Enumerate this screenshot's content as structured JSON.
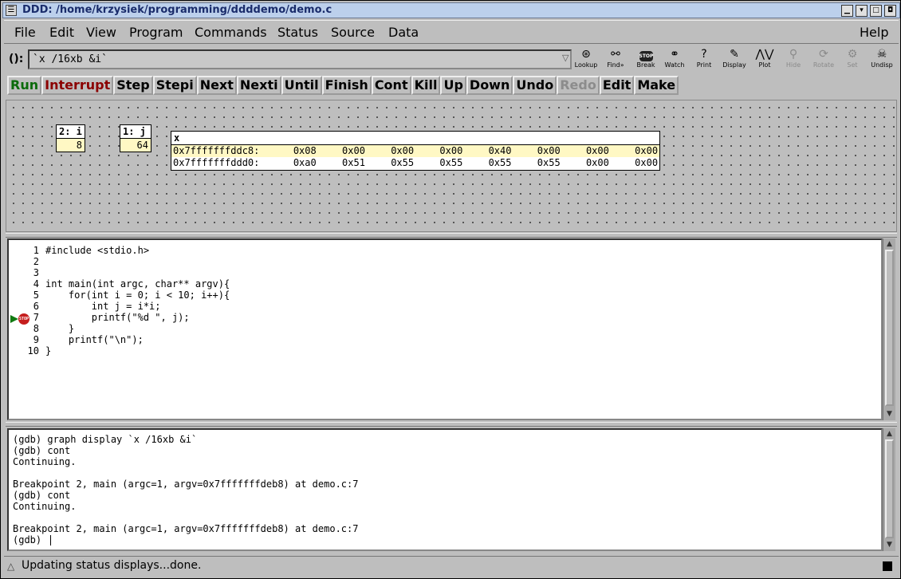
{
  "window": {
    "title": "DDD: /home/krzysiek/programming/ddddemo/demo.c"
  },
  "menubar": {
    "items": [
      "File",
      "Edit",
      "View",
      "Program",
      "Commands",
      "Status",
      "Source",
      "Data"
    ],
    "help": "Help"
  },
  "argbar": {
    "label": "():",
    "value": "`x /16xb &i`"
  },
  "toolbar": [
    {
      "label": "Lookup",
      "icon": "lookup-icon",
      "enabled": true
    },
    {
      "label": "Find»",
      "icon": "binoculars-icon",
      "enabled": true
    },
    {
      "label": "Break",
      "icon": "stop-sign-icon",
      "enabled": true
    },
    {
      "label": "Watch",
      "icon": "glasses-icon",
      "enabled": true
    },
    {
      "label": "Print",
      "icon": "question-icon",
      "enabled": true
    },
    {
      "label": "Display",
      "icon": "display-icon",
      "enabled": true
    },
    {
      "label": "Plot",
      "icon": "plot-icon",
      "enabled": true
    },
    {
      "label": "Hide",
      "icon": "magnifier-icon",
      "enabled": false
    },
    {
      "label": "Rotate",
      "icon": "rotate-icon",
      "enabled": false
    },
    {
      "label": "Set",
      "icon": "gear-icon",
      "enabled": false
    },
    {
      "label": "Undisp",
      "icon": "skull-icon",
      "enabled": true
    }
  ],
  "commands": [
    {
      "label": "Run",
      "style": "run"
    },
    {
      "label": "Interrupt",
      "style": "interrupt"
    },
    {
      "label": "Step",
      "style": ""
    },
    {
      "label": "Stepi",
      "style": ""
    },
    {
      "label": "Next",
      "style": ""
    },
    {
      "label": "Nexti",
      "style": ""
    },
    {
      "label": "Until",
      "style": ""
    },
    {
      "label": "Finish",
      "style": ""
    },
    {
      "label": "Cont",
      "style": ""
    },
    {
      "label": "Kill",
      "style": ""
    },
    {
      "label": "Up",
      "style": ""
    },
    {
      "label": "Down",
      "style": ""
    },
    {
      "label": "Undo",
      "style": ""
    },
    {
      "label": "Redo",
      "style": "disabled"
    },
    {
      "label": "Edit",
      "style": ""
    },
    {
      "label": "Make",
      "style": ""
    }
  ],
  "displays": {
    "i": {
      "header": "2: i",
      "value": "8"
    },
    "j": {
      "header": "1: j",
      "value": "64"
    },
    "x": {
      "header": "x",
      "rows": [
        {
          "addr": "0x7fffffffddc8:",
          "bytes": [
            "0x08",
            "0x00",
            "0x00",
            "0x00",
            "0x40",
            "0x00",
            "0x00",
            "0x00"
          ],
          "changed": true
        },
        {
          "addr": "0x7fffffffddd0:",
          "bytes": [
            "0xa0",
            "0x51",
            "0x55",
            "0x55",
            "0x55",
            "0x55",
            "0x00",
            "0x00"
          ],
          "changed": false
        }
      ]
    }
  },
  "source": {
    "lines": [
      {
        "n": "1",
        "code": "#include <stdio.h>"
      },
      {
        "n": "2",
        "code": ""
      },
      {
        "n": "3",
        "code": ""
      },
      {
        "n": "4",
        "code": "int main(int argc, char** argv){"
      },
      {
        "n": "5",
        "code": "    for(int i = 0; i < 10; i++){"
      },
      {
        "n": "6",
        "code": "        int j = i*i;"
      },
      {
        "n": "7",
        "code": "        printf(\"%d \", j);"
      },
      {
        "n": "8",
        "code": "    }"
      },
      {
        "n": "9",
        "code": "    printf(\"\\n\");"
      },
      {
        "n": "10",
        "code": "}"
      }
    ],
    "breakpoint_line": "7",
    "stop_text": "STOP"
  },
  "console": {
    "lines": [
      "(gdb) graph display `x /16xb &i`",
      "(gdb) cont",
      "Continuing.",
      "",
      "Breakpoint 2, main (argc=1, argv=0x7fffffffdeb8) at demo.c:7",
      "(gdb) cont",
      "Continuing.",
      "",
      "Breakpoint 2, main (argc=1, argv=0x7fffffffdeb8) at demo.c:7",
      "(gdb) "
    ]
  },
  "status": {
    "text": "Updating status displays...done."
  }
}
